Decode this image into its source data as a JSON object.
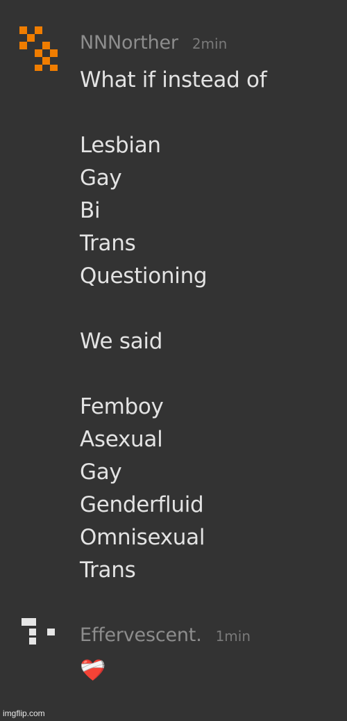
{
  "messages": [
    {
      "username": "NNNorther",
      "time": "2min",
      "avatar_icon": "orange-pixel-avatar-icon",
      "avatar_color": "#f07d00",
      "lines": [
        "What if instead of",
        "",
        "Lesbian",
        "Gay",
        "Bi",
        "Trans",
        "Questioning",
        "",
        "We said",
        "",
        "Femboy",
        "Asexual",
        "Gay",
        "Genderfluid",
        "Omnisexual",
        "Trans"
      ]
    },
    {
      "username": "Effervescent.",
      "time": "1min",
      "avatar_icon": "gray-pixel-avatar-icon",
      "avatar_color": "#e6e6e6",
      "reaction": "❤️‍🩹",
      "reaction_icon": "mending-heart-icon"
    }
  ],
  "watermark": "imgflip.com"
}
